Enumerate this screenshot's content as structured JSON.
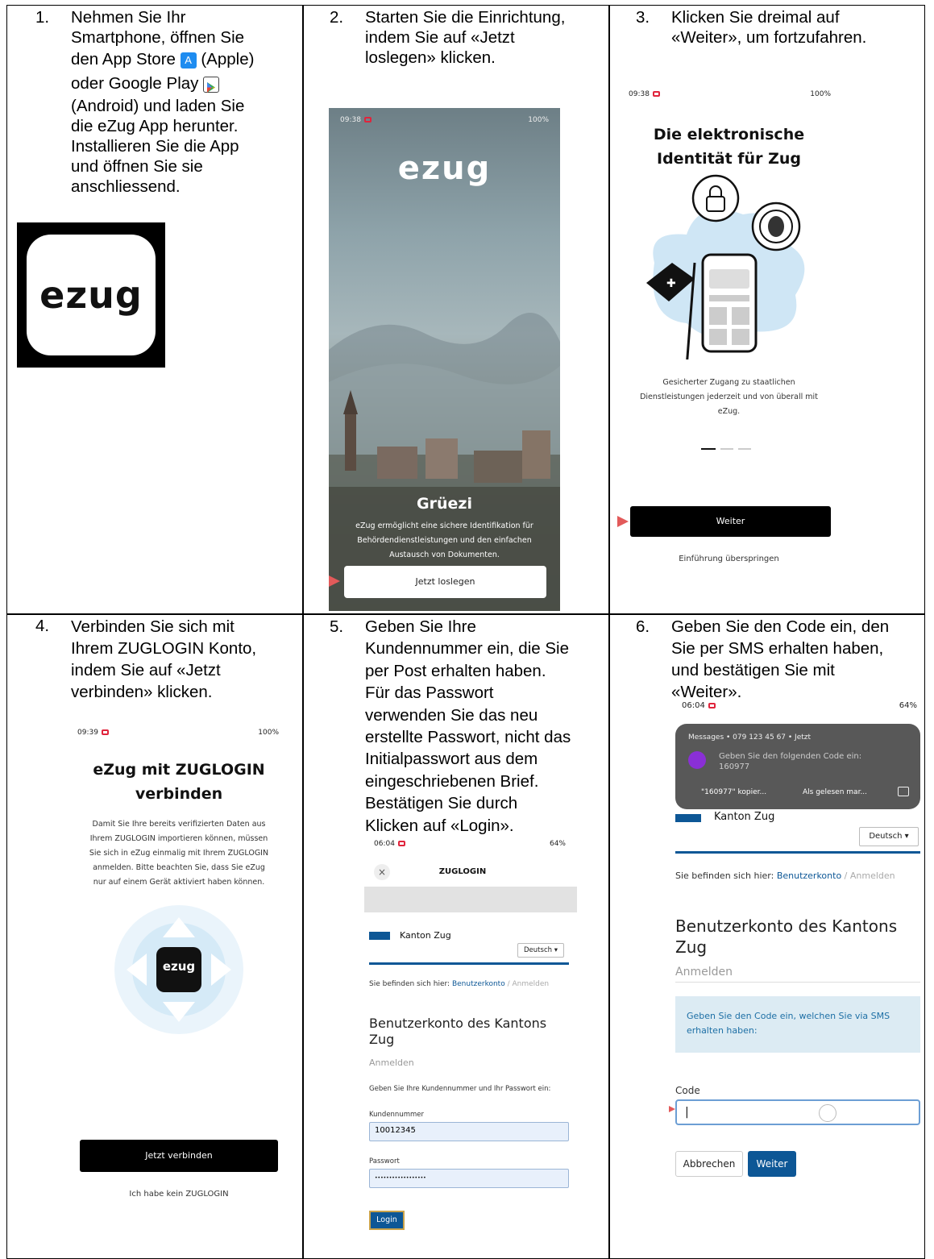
{
  "steps": [
    {
      "num": "1.",
      "lines": [
        "Nehmen Sie Ihr",
        "Smartphone, öffnen Sie",
        "den App Store",
        "(Apple)",
        "oder Google Play",
        "(Android) und laden Sie",
        "die eZug App herunter.",
        "Installieren Sie die App",
        "und öffnen Sie sie",
        "anschliessend."
      ]
    },
    {
      "num": "2.",
      "lines": [
        "Starten Sie die Einrichtung,",
        "indem Sie auf «Jetzt",
        "loslegen» klicken."
      ]
    },
    {
      "num": "3.",
      "lines": [
        "Klicken Sie dreimal auf",
        "«Weiter», um fortzufahren."
      ]
    },
    {
      "num": "4.",
      "lines": [
        "Verbinden Sie sich mit",
        "Ihrem ZUGLOGIN Konto,",
        "indem Sie auf «Jetzt",
        "verbinden» klicken."
      ]
    },
    {
      "num": "5.",
      "lines": [
        "Geben Sie Ihre",
        "Kundennummer ein, die Sie",
        "per Post erhalten haben.",
        "Für das Passwort",
        "verwenden Sie das neu",
        "erstellte Passwort, nicht das",
        "Initialpasswort aus dem",
        "eingeschriebenen Brief.",
        "Bestätigen Sie durch",
        "Klicken auf «Login»."
      ]
    },
    {
      "num": "6.",
      "lines": [
        "Geben Sie den Code ein, den",
        "Sie per SMS erhalten haben,",
        "und bestätigen Sie mit",
        "«Weiter»."
      ]
    }
  ],
  "app_icon": {
    "text": "ezug"
  },
  "screen2": {
    "time": "09:38",
    "status": "100%",
    "logo": "ezug",
    "title": "Grüezi",
    "body": [
      "eZug ermöglicht eine sichere Identifikation für",
      "Behördendienstleistungen und den einfachen",
      "Austausch von Dokumenten."
    ],
    "button": "Jetzt loslegen"
  },
  "screen3": {
    "time": "09:38",
    "status": "100%",
    "title": [
      "Die elektronische",
      "Identität für Zug"
    ],
    "body": [
      "Gesicherter Zugang zu staatlichen",
      "Dienstleistungen jederzeit und von überall mit",
      "eZug."
    ],
    "button": "Weiter",
    "skip": "Einführung überspringen"
  },
  "screen4": {
    "time": "09:39",
    "status": "100%",
    "title": [
      "eZug mit ZUGLOGIN",
      "verbinden"
    ],
    "body": [
      "Damit Sie Ihre bereits verifizierten Daten aus",
      "Ihrem ZUGLOGIN importieren können, müssen",
      "Sie sich in eZug einmalig mit Ihrem ZUGLOGIN",
      "anmelden. Bitte beachten Sie, dass Sie eZug",
      "nur auf einem Gerät aktiviert haben können."
    ],
    "logo": "ezug",
    "button": "Jetzt verbinden",
    "link": "Ich habe kein ZUGLOGIN"
  },
  "screen5": {
    "time": "06:04",
    "status": "64%",
    "header": "ZUGLOGIN",
    "close": "×",
    "canton": "Kanton Zug",
    "lang": "Deutsch ▾",
    "breadcrumb_prefix": "Sie befinden sich hier:",
    "breadcrumb_link": "Benutzerkonto",
    "breadcrumb_sep": "/",
    "breadcrumb_current": "Anmelden",
    "title": [
      "Benutzerkonto des Kantons",
      "Zug"
    ],
    "subtitle": "Anmelden",
    "instruction": "Geben Sie Ihre Kundennummer und Ihr Passwort ein:",
    "label_customer": "Kundennummer",
    "customer_value": "10012345",
    "label_password": "Passwort",
    "password_value": "••••••••••••••••••",
    "login": "Login"
  },
  "screen6": {
    "time": "06:04",
    "status": "64%",
    "notif_app": "Messages",
    "notif_sender": "079 123 45 67",
    "notif_when": "Jetzt",
    "notif_text": "Geben Sie den folgenden Code ein:",
    "notif_code": "160977",
    "notif_copy": "\"160977\" kopier...",
    "notif_read": "Als gelesen mar...",
    "canton": "Kanton Zug",
    "lang": "Deutsch ▾",
    "breadcrumb_prefix": "Sie befinden sich hier:",
    "breadcrumb_link": "Benutzerkonto",
    "breadcrumb_sep": "/",
    "breadcrumb_current": "Anmelden",
    "title": [
      "Benutzerkonto des Kantons",
      "Zug"
    ],
    "subtitle": "Anmelden",
    "info": [
      "Geben Sie den Code ein, welchen Sie via SMS",
      "erhalten haben:"
    ],
    "label_code": "Code",
    "code_value": "|",
    "cancel": "Abbrechen",
    "next": "Weiter"
  }
}
